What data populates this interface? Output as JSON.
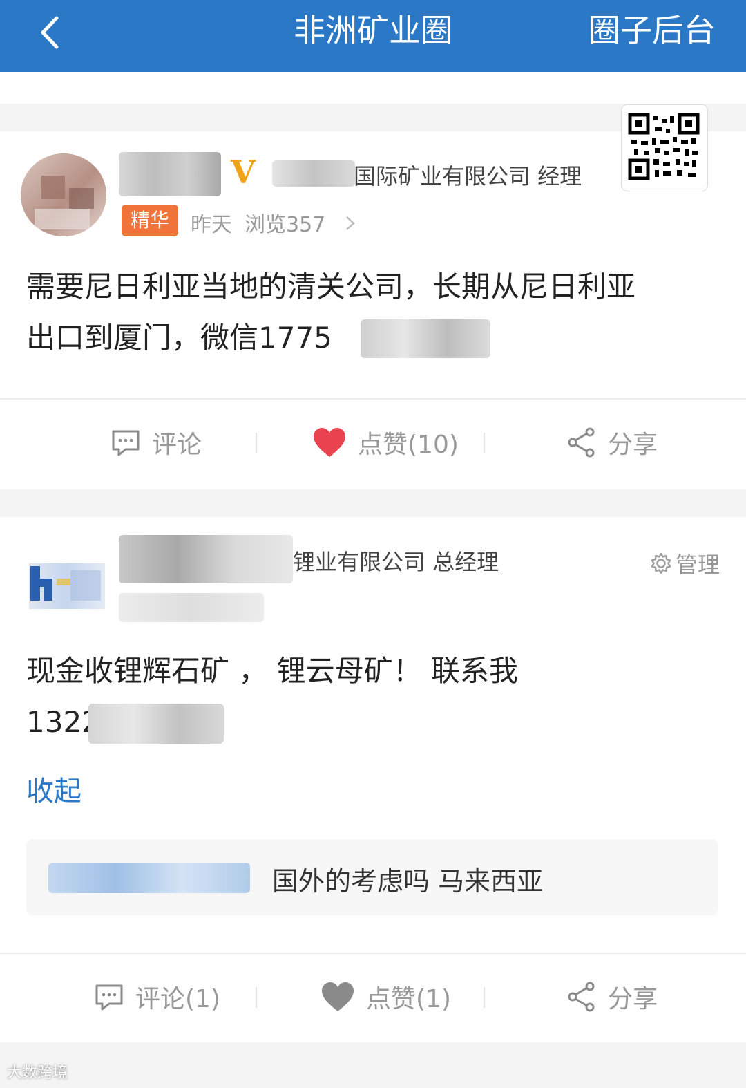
{
  "header": {
    "title": "非洲矿业圈",
    "right_label": "圈子后台",
    "back_icon": "chevron-left-icon"
  },
  "post1": {
    "company_visible": "国际矿业有限公司 经理",
    "badge": "V",
    "tag": "精华",
    "time": "昨天",
    "views": "浏览357",
    "content_line1": "需要尼日利亚当地的清关公司，长期从尼日利亚",
    "content_line2": "出口到厦门，微信1775",
    "actions": {
      "comment": "评论",
      "like": "点赞(10)",
      "share": "分享"
    }
  },
  "post2": {
    "company_visible": "锂业有限公司 总经理",
    "manage": "管理",
    "content_line1": "现金收锂辉石矿 ， 锂云母矿！ 联系我",
    "content_line2": "1322",
    "collapse": "收起",
    "comment_text": "国外的考虑吗 马来西亚",
    "actions": {
      "comment": "评论(1)",
      "like": "点赞(1)",
      "share": "分享"
    }
  },
  "watermark": "大数跨境",
  "colors": {
    "header_bg": "#2b78c7",
    "tag_bg": "#f0743a",
    "badge": "#f0a31a",
    "like_active": "#e8434f",
    "link": "#2b78c7"
  }
}
